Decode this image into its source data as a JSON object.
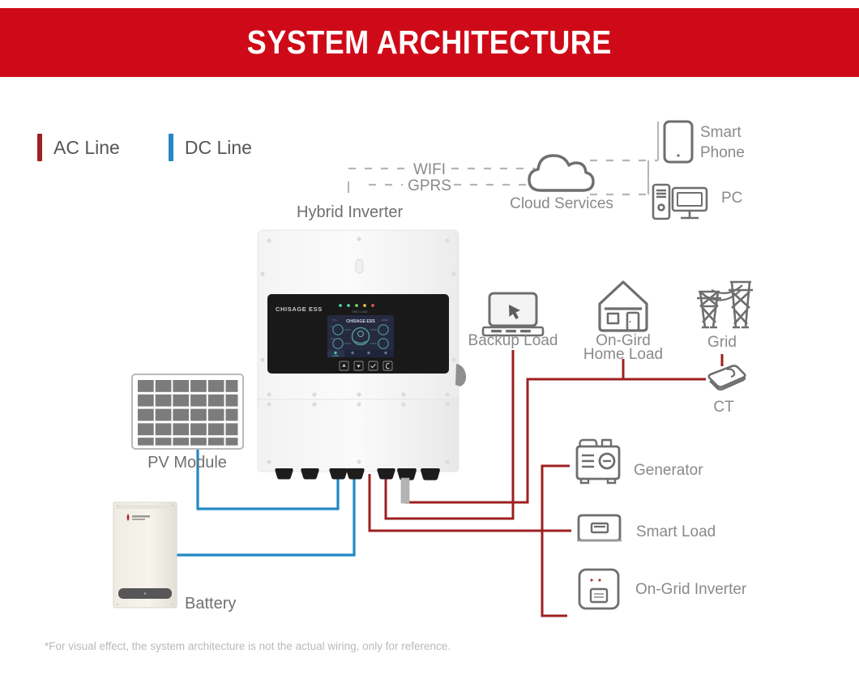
{
  "header": {
    "title": "SYSTEM ARCHITECTURE",
    "background_color": "#cf0a18",
    "text_color": "#ffffff"
  },
  "legend": {
    "items": [
      {
        "label": "AC Line",
        "color": "#9e2020",
        "icon": "ac-line-swatch"
      },
      {
        "label": "DC Line",
        "color": "#2388c4",
        "icon": "dc-line-swatch"
      }
    ]
  },
  "colors": {
    "ac_line": "#9e2020",
    "dc_line": "#2388c4",
    "icon_gray": "#6e6e6e",
    "label_gray": "#8a8a8a",
    "banner_red": "#cf0a18",
    "dashed_gray": "#b5b5b5"
  },
  "communication": {
    "protocols": [
      {
        "label": "WIFI",
        "icon": "wifi-dashed-link"
      },
      {
        "label": "GPRS",
        "icon": "gprs-dashed-link"
      }
    ],
    "cloud": {
      "label": "Cloud Services",
      "icon": "cloud-icon"
    },
    "endpoints": [
      {
        "label": "Smart Phone",
        "line1": "Smart",
        "line2": "Phone",
        "icon": "smartphone-icon"
      },
      {
        "label": "PC",
        "line1": "PC",
        "line2": "",
        "icon": "desktop-pc-icon"
      }
    ]
  },
  "devices": {
    "inverter": {
      "label": "Hybrid Inverter",
      "icon": "hybrid-inverter-unit",
      "brand": "CHISAGE ESS"
    },
    "pv": {
      "label": "PV Module",
      "icon": "pv-panel-icon"
    },
    "battery": {
      "label": "Battery",
      "icon": "battery-cabinet-icon"
    },
    "backup_load": {
      "label": "Backup Load",
      "icon": "laptop-icon"
    },
    "home_load": {
      "label": "On-Gird Home Load",
      "line1": "On-Gird",
      "line2": "Home Load",
      "icon": "house-icon"
    },
    "grid": {
      "label": "Grid",
      "icon": "transmission-tower-icon"
    },
    "ct": {
      "label": "CT",
      "icon": "current-transformer-icon"
    },
    "generator": {
      "label": "Generator",
      "icon": "generator-icon"
    },
    "smart_load": {
      "label": "Smart Load",
      "icon": "smart-load-icon"
    },
    "ongrid_inverter": {
      "label": "On-Grid Inverter",
      "icon": "ongrid-inverter-icon"
    }
  },
  "footer": {
    "note": "*For visual effect, the system architecture is not the actual wiring, only for reference."
  }
}
